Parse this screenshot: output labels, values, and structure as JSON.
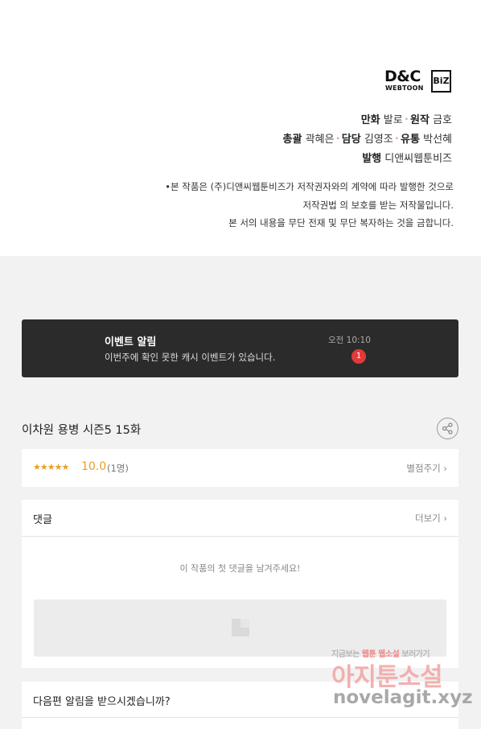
{
  "logo": {
    "brand": "D&C",
    "sub": "WEBTOON",
    "badge": "BiZ"
  },
  "credits": {
    "line1": {
      "label_a": "만화",
      "value_a": "발로",
      "label_b": "원작",
      "value_b": "금호"
    },
    "line2": {
      "label_a": "총괄",
      "value_a": "곽혜은",
      "label_b": "담당",
      "value_b": "김영조",
      "label_c": "유통",
      "value_c": "박선혜"
    },
    "line3": {
      "label_a": "발행",
      "value_a": "디앤씨웹툰비즈"
    },
    "separator": "•"
  },
  "notice": {
    "line1": "•본 작품은 (주)디앤씨웹툰비즈가 저작권자와의 계약에 따라 발행한 것으로",
    "line2": "저작권법 의 보호를 받는 저작물입니다.",
    "line3": "본 서의 내용을 무단 전재 및 무단 복자하는 것을 금합니다."
  },
  "notification": {
    "title": "이벤트 알림",
    "message": "이번주에 확인 못한 캐시 이벤트가 있습니다.",
    "time": "오전 10:10",
    "badge": "1"
  },
  "episode": {
    "title": "이차원 용병 시즌5 15화"
  },
  "rating": {
    "stars": "★★★★★",
    "value": "10.0",
    "count": "(1명)",
    "rate_link": "별점주기 ›"
  },
  "comments": {
    "label": "댓글",
    "more_link": "더보기 ›",
    "empty_message": "이 작품의 첫 댓글을 남겨주세요!"
  },
  "next_episode": {
    "question": "다음편 알림을 받으시겠습니까?"
  },
  "watermark": {
    "tagline_a": "지금보는",
    "tagline_b": "웹툰",
    "tagline_c": "웹소설",
    "tagline_d": "보러가기",
    "site_name": "아지툰소설",
    "url": "novelagit.xyz"
  },
  "colors": {
    "accent_star": "#e8a020",
    "badge_red": "#e03a3a",
    "notification_bg": "#2b2b2b"
  }
}
